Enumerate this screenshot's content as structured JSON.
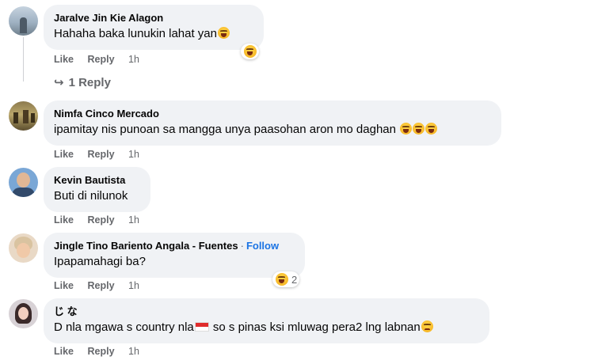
{
  "comments": [
    {
      "author": "Jaralve Jin Kie Alagon",
      "text": "Hahaha baka lunukin lahat yan",
      "like": "Like",
      "reply": "Reply",
      "time": "1h",
      "reaction_count": ""
    },
    {
      "author": "Nimfa Cinco Mercado",
      "text": "ipamitay nis punoan sa mangga unya paasohan aron mo daghan",
      "like": "Like",
      "reply": "Reply",
      "time": "1h"
    },
    {
      "author": "Kevin Bautista",
      "text": "Buti di nilunok",
      "like": "Like",
      "reply": "Reply",
      "time": "1h"
    },
    {
      "author": "Jingle Tino Bariento Angala - Fuentes",
      "follow": "Follow",
      "separator": "·",
      "text": "Ipapamahagi ba?",
      "like": "Like",
      "reply": "Reply",
      "time": "1h",
      "reaction_count": "2"
    },
    {
      "author": "じ な",
      "text_a": "D nla mgawa s country nla",
      "text_b": " so s pinas ksi mluwag pera2 lng labnan",
      "like": "Like",
      "reply": "Reply",
      "time": "1h"
    }
  ],
  "replies_link": "1 Reply",
  "reply_arrow": "↪",
  "colors": {
    "bubble": "#f0f2f5",
    "meta": "#65676b",
    "follow": "#1b74e4"
  }
}
